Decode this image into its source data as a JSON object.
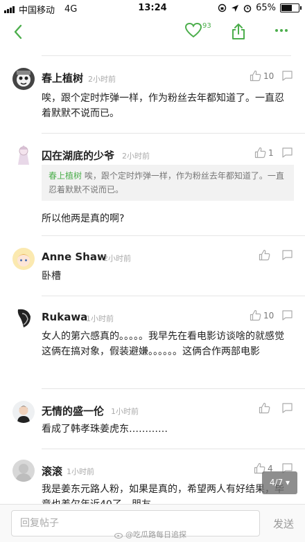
{
  "status_bar": {
    "carrier": "中国移动",
    "network": "4G",
    "time": "13:24",
    "battery": "65%"
  },
  "nav": {
    "like_count": "93",
    "accent_color": "#4cae4c"
  },
  "comments": [
    {
      "user": "春上植树",
      "time": "2小时前",
      "likes": "10",
      "text": "唉，跟个定时炸弹一样，作为粉丝去年都知道了。一直忍着默默不说而已。"
    },
    {
      "user": "囚在湖底的少爷",
      "time": "2小时前",
      "likes": "1",
      "quote_author": "春上植树",
      "quote_text": "唉，跟个定时炸弹一样，作为粉丝去年都知道了。一直忍着默默不说而已。",
      "text": "所以他两是真的啊?"
    },
    {
      "user": "Anne Shaw",
      "time": "2小时前",
      "likes": "",
      "text": "卧槽"
    },
    {
      "user": "Rukawa",
      "time": "1小时前",
      "likes": "10",
      "text": "女人的第六感真的。。。。。我早先在看电影访谈啥的就感觉这俩在搞对象，假装避嫌。。。。。。这俩合作两部电影"
    },
    {
      "user": "无情的盛一伦",
      "time": "1小时前",
      "likes": "",
      "text": "看成了韩孝珠姜虎东…………"
    },
    {
      "user": "滚滚",
      "time": "1小时前",
      "likes": "4",
      "text": "我是姜东元路人粉，如果是真的，希望两人有好结果，毕竟也差欠年近40了，朋友"
    }
  ],
  "page_indicator": "4/7 ▾",
  "reply_bar": {
    "placeholder": "回复帖子",
    "send_label": "发送"
  },
  "watermark": "@吃瓜路每日追探"
}
